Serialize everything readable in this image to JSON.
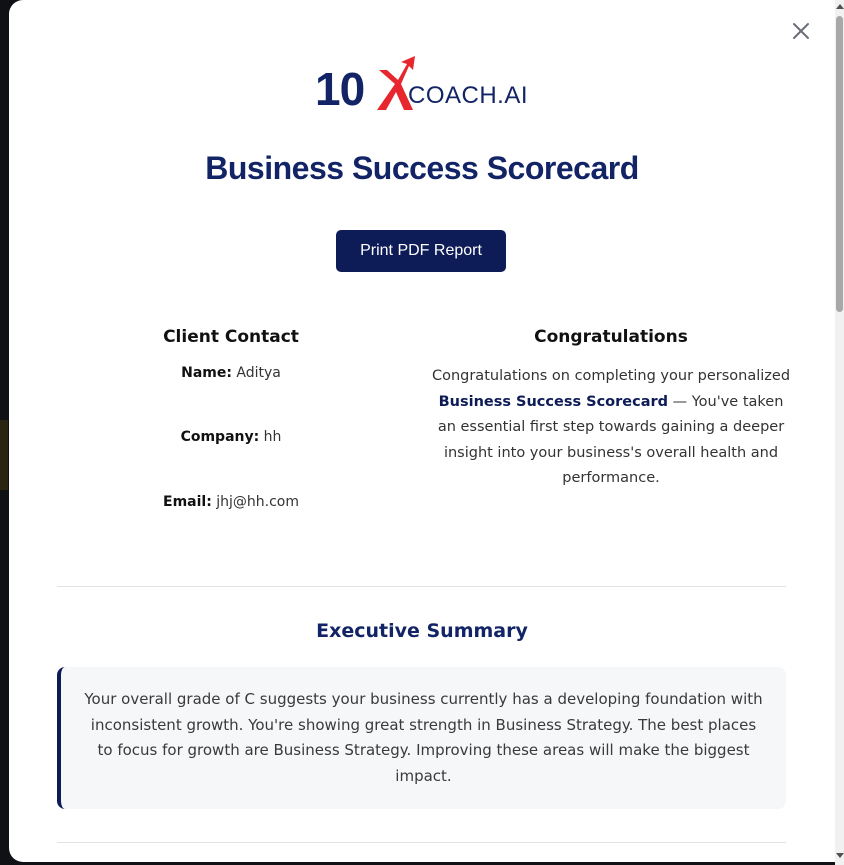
{
  "brand": {
    "logo_number": "10",
    "logo_x": "X",
    "logo_text": "COACH.AI",
    "colors": {
      "navy": "#122466",
      "red": "#e8262e",
      "button": "#0d1b57"
    }
  },
  "icons": {
    "close": "close-icon"
  },
  "page": {
    "title": "Business Success Scorecard",
    "print_button": "Print PDF Report"
  },
  "client_contact": {
    "heading": "Client Contact",
    "name_label": "Name:",
    "name_value": "Aditya",
    "company_label": "Company:",
    "company_value": "hh",
    "email_label": "Email:",
    "email_value": "jhj@hh.com"
  },
  "congratulations": {
    "heading": "Congratulations",
    "text_before": "Congratulations on completing your personalized ",
    "text_bold": "Business Success Scorecard",
    "text_after": " — You've taken an essential first step towards gaining a deeper insight into your business's overall health and performance."
  },
  "executive_summary": {
    "heading": "Executive Summary",
    "text": "Your overall grade of C suggests your business currently has a developing foundation with inconsistent growth. You're showing great strength in Business Strategy. The best places to focus for growth are Business Strategy. Improving these areas will make the biggest impact."
  }
}
